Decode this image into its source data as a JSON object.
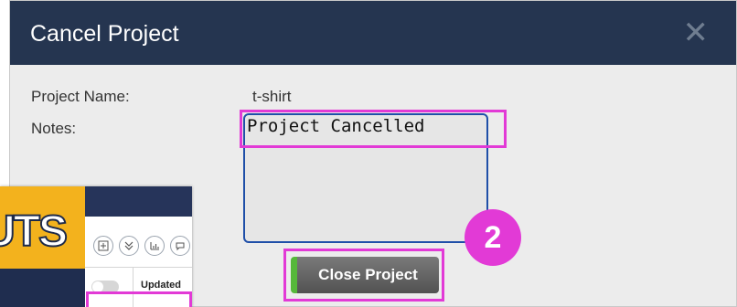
{
  "dialog": {
    "title": "Cancel Project",
    "close_glyph": "✕",
    "fields": {
      "project_name_label": "Project Name:",
      "project_name_value": "t-shirt",
      "notes_label": "Notes:",
      "notes_value": "Project Cancelled"
    },
    "close_project_button": "Close Project"
  },
  "step_badge": "2",
  "inset": {
    "logo_text": "UTS",
    "toolbar_icons": [
      "plus-icon",
      "double-chevron-icon",
      "chart-icon",
      "comment-icon"
    ],
    "column_header": "Updated"
  },
  "colors": {
    "header": "#253550",
    "highlight": "#e23ad6",
    "button_accent": "#56b83a",
    "notes_border": "#1f4fa8",
    "logo_yellow": "#f3b21d"
  }
}
